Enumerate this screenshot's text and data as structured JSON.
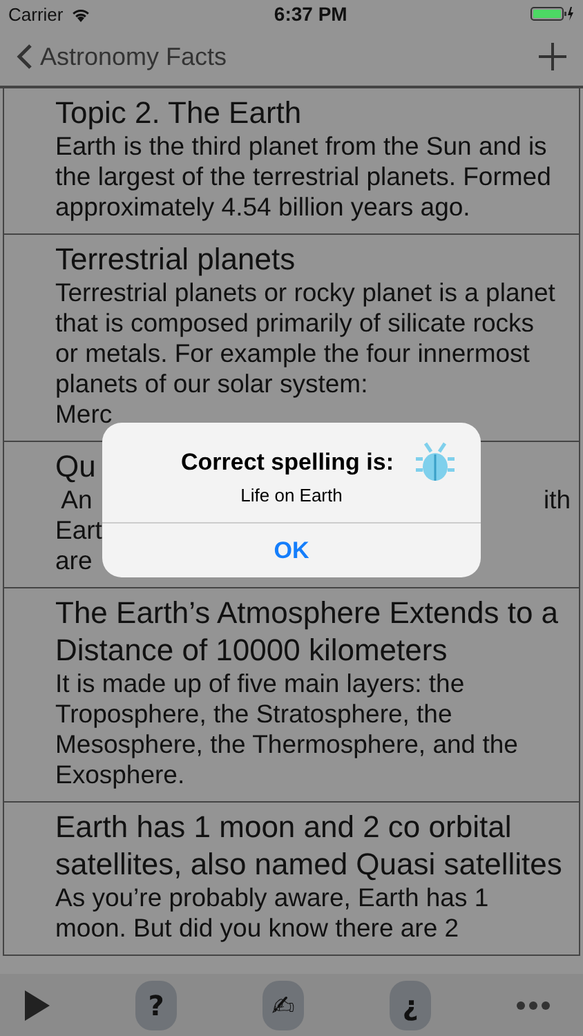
{
  "status_bar": {
    "carrier": "Carrier",
    "time": "6:37 PM"
  },
  "nav": {
    "back": "Astronomy Facts"
  },
  "rows": [
    {
      "kind": "full",
      "title": "Topic 2. The Earth",
      "body": " Earth is the third planet from the Sun and is the largest of the terrestrial planets. Formed approximately 4.54 billion years ago."
    },
    {
      "kind": "full",
      "title": "Terrestrial planets",
      "body": " Terrestrial planets or rocky planet is a planet that is composed primarily of silicate rocks or metals. For example the four innermost planets of our solar system:",
      "tail": "Merc"
    },
    {
      "kind": "covered",
      "title": "Qu",
      "lines": [
        {
          "left": " An",
          "right": "ith"
        },
        {
          "left": "Eart"
        },
        {
          "left": "are"
        }
      ]
    },
    {
      "kind": "full",
      "title": "The Earth’s Atmosphere Extends to a Distance of 10000 kilometers",
      "body": " It is made up of five main layers: the Troposphere, the Stratosphere, the Mesosphere, the Thermosphere, and the Exosphere."
    },
    {
      "kind": "full",
      "title": "Earth has 1 moon and 2 co orbital satellites, also named Quasi satellites",
      "body": " As you’re probably aware, Earth has 1 moon. But did you know there are 2"
    }
  ],
  "alert": {
    "title": "Correct spelling is:",
    "message": "Life on Earth",
    "button": "OK"
  },
  "toolbar": [
    {
      "kind": "play"
    },
    {
      "kind": "text",
      "label": "?"
    },
    {
      "kind": "text",
      "label": "✍"
    },
    {
      "kind": "text",
      "label": "¿"
    },
    {
      "kind": "more"
    }
  ]
}
